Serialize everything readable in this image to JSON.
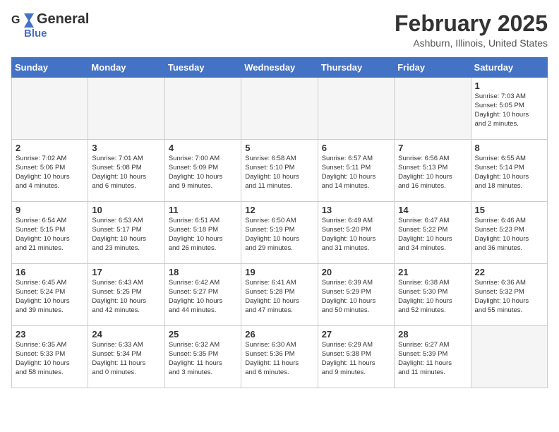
{
  "header": {
    "logo": {
      "general": "General",
      "blue": "Blue"
    },
    "month": "February 2025",
    "location": "Ashburn, Illinois, United States"
  },
  "weekdays": [
    "Sunday",
    "Monday",
    "Tuesday",
    "Wednesday",
    "Thursday",
    "Friday",
    "Saturday"
  ],
  "weeks": [
    [
      {
        "day": "",
        "info": "",
        "empty": true
      },
      {
        "day": "",
        "info": "",
        "empty": true
      },
      {
        "day": "",
        "info": "",
        "empty": true
      },
      {
        "day": "",
        "info": "",
        "empty": true
      },
      {
        "day": "",
        "info": "",
        "empty": true
      },
      {
        "day": "",
        "info": "",
        "empty": true
      },
      {
        "day": "1",
        "info": "Sunrise: 7:03 AM\nSunset: 5:05 PM\nDaylight: 10 hours\nand 2 minutes."
      }
    ],
    [
      {
        "day": "2",
        "info": "Sunrise: 7:02 AM\nSunset: 5:06 PM\nDaylight: 10 hours\nand 4 minutes."
      },
      {
        "day": "3",
        "info": "Sunrise: 7:01 AM\nSunset: 5:08 PM\nDaylight: 10 hours\nand 6 minutes."
      },
      {
        "day": "4",
        "info": "Sunrise: 7:00 AM\nSunset: 5:09 PM\nDaylight: 10 hours\nand 9 minutes."
      },
      {
        "day": "5",
        "info": "Sunrise: 6:58 AM\nSunset: 5:10 PM\nDaylight: 10 hours\nand 11 minutes."
      },
      {
        "day": "6",
        "info": "Sunrise: 6:57 AM\nSunset: 5:11 PM\nDaylight: 10 hours\nand 14 minutes."
      },
      {
        "day": "7",
        "info": "Sunrise: 6:56 AM\nSunset: 5:13 PM\nDaylight: 10 hours\nand 16 minutes."
      },
      {
        "day": "8",
        "info": "Sunrise: 6:55 AM\nSunset: 5:14 PM\nDaylight: 10 hours\nand 18 minutes."
      }
    ],
    [
      {
        "day": "9",
        "info": "Sunrise: 6:54 AM\nSunset: 5:15 PM\nDaylight: 10 hours\nand 21 minutes."
      },
      {
        "day": "10",
        "info": "Sunrise: 6:53 AM\nSunset: 5:17 PM\nDaylight: 10 hours\nand 23 minutes."
      },
      {
        "day": "11",
        "info": "Sunrise: 6:51 AM\nSunset: 5:18 PM\nDaylight: 10 hours\nand 26 minutes."
      },
      {
        "day": "12",
        "info": "Sunrise: 6:50 AM\nSunset: 5:19 PM\nDaylight: 10 hours\nand 29 minutes."
      },
      {
        "day": "13",
        "info": "Sunrise: 6:49 AM\nSunset: 5:20 PM\nDaylight: 10 hours\nand 31 minutes."
      },
      {
        "day": "14",
        "info": "Sunrise: 6:47 AM\nSunset: 5:22 PM\nDaylight: 10 hours\nand 34 minutes."
      },
      {
        "day": "15",
        "info": "Sunrise: 6:46 AM\nSunset: 5:23 PM\nDaylight: 10 hours\nand 36 minutes."
      }
    ],
    [
      {
        "day": "16",
        "info": "Sunrise: 6:45 AM\nSunset: 5:24 PM\nDaylight: 10 hours\nand 39 minutes."
      },
      {
        "day": "17",
        "info": "Sunrise: 6:43 AM\nSunset: 5:25 PM\nDaylight: 10 hours\nand 42 minutes."
      },
      {
        "day": "18",
        "info": "Sunrise: 6:42 AM\nSunset: 5:27 PM\nDaylight: 10 hours\nand 44 minutes."
      },
      {
        "day": "19",
        "info": "Sunrise: 6:41 AM\nSunset: 5:28 PM\nDaylight: 10 hours\nand 47 minutes."
      },
      {
        "day": "20",
        "info": "Sunrise: 6:39 AM\nSunset: 5:29 PM\nDaylight: 10 hours\nand 50 minutes."
      },
      {
        "day": "21",
        "info": "Sunrise: 6:38 AM\nSunset: 5:30 PM\nDaylight: 10 hours\nand 52 minutes."
      },
      {
        "day": "22",
        "info": "Sunrise: 6:36 AM\nSunset: 5:32 PM\nDaylight: 10 hours\nand 55 minutes."
      }
    ],
    [
      {
        "day": "23",
        "info": "Sunrise: 6:35 AM\nSunset: 5:33 PM\nDaylight: 10 hours\nand 58 minutes."
      },
      {
        "day": "24",
        "info": "Sunrise: 6:33 AM\nSunset: 5:34 PM\nDaylight: 11 hours\nand 0 minutes."
      },
      {
        "day": "25",
        "info": "Sunrise: 6:32 AM\nSunset: 5:35 PM\nDaylight: 11 hours\nand 3 minutes."
      },
      {
        "day": "26",
        "info": "Sunrise: 6:30 AM\nSunset: 5:36 PM\nDaylight: 11 hours\nand 6 minutes."
      },
      {
        "day": "27",
        "info": "Sunrise: 6:29 AM\nSunset: 5:38 PM\nDaylight: 11 hours\nand 9 minutes."
      },
      {
        "day": "28",
        "info": "Sunrise: 6:27 AM\nSunset: 5:39 PM\nDaylight: 11 hours\nand 11 minutes."
      },
      {
        "day": "",
        "info": "",
        "empty": true
      }
    ]
  ]
}
